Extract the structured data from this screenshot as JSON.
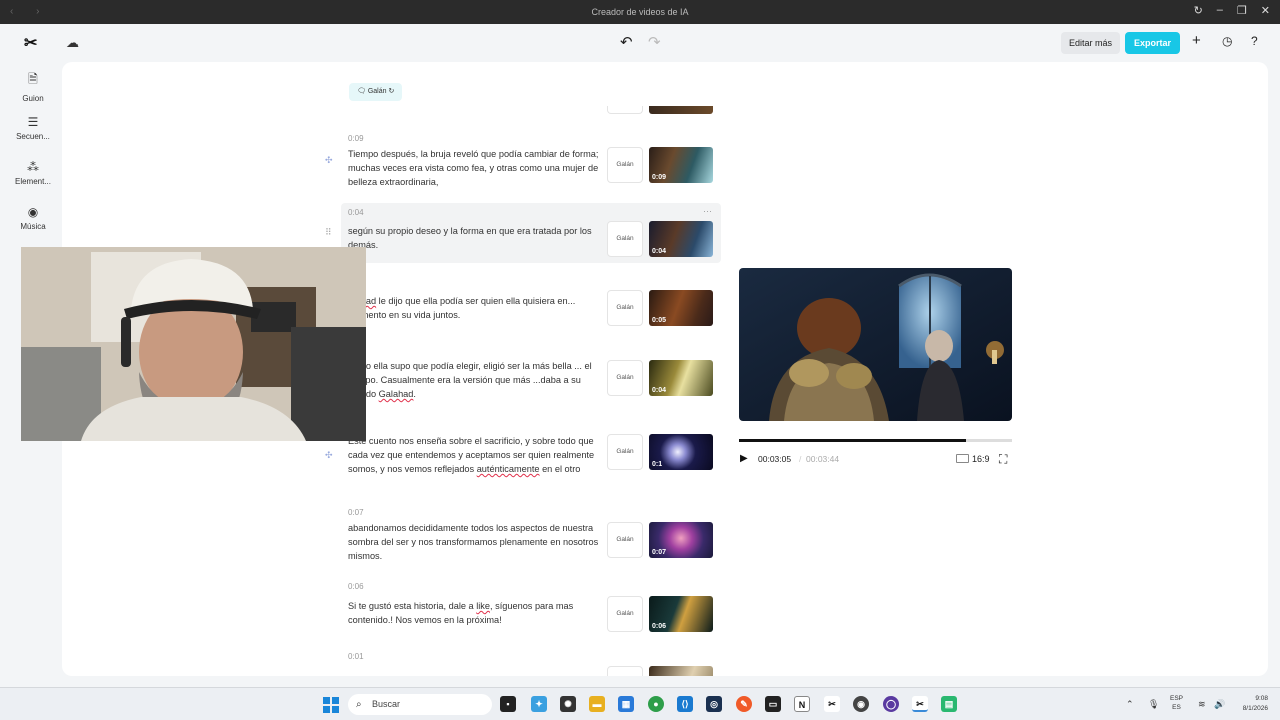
{
  "window": {
    "title": "Creador de videos de IA"
  },
  "toolbar": {
    "logo": "✂",
    "edit_more": "Editar más",
    "export": "Exportar"
  },
  "sidebar": {
    "items": [
      {
        "label": "Guion",
        "icon": "script-icon"
      },
      {
        "label": "Secuen...",
        "icon": "sequence-icon"
      },
      {
        "label": "Element...",
        "icon": "elements-icon"
      },
      {
        "label": "Música",
        "icon": "music-icon"
      }
    ]
  },
  "voice_chip": {
    "label": "Galán"
  },
  "segments": [
    {
      "duration": "0:09",
      "text": "Tiempo después, la bruja reveló que podía cambiar de forma; muchas veces era vista como fea, y otras como una mujer de belleza extraordinaria,",
      "voice": "Galán",
      "thumb_label": "0:09"
    },
    {
      "duration": "0:04",
      "text": "según su propio deseo y la forma en que era tratada por los demás.",
      "voice": "Galán",
      "thumb_label": "0:04"
    },
    {
      "duration": "",
      "text_pre": "",
      "text_wavy": "...ahad",
      "text_post": " le dijo que ella podía ser quien ella quisiera en... momento en su vida juntos.",
      "voice": "Galán",
      "thumb_label": "0:05"
    },
    {
      "duration": "",
      "text_pre": "...ndo ella supo que podía elegir, eligió ser la más bella ... el tiempo. Casualmente era la versión que más ...daba a su amado ",
      "text_wavy": "Galahad",
      "text_post": ".",
      "voice": "Galán",
      "thumb_label": "0:04"
    },
    {
      "duration": "",
      "text_pre": "Este cuento nos enseña sobre el sacrificio, y sobre todo que cada vez que entendemos y aceptamos ser quien realmente somos, y nos vemos reflejados ",
      "text_wavy": "auténticamente",
      "text_post": " en el otro",
      "voice": "Galán",
      "thumb_label": "0:1"
    },
    {
      "duration": "0:07",
      "text": "abandonamos decididamente todos los aspectos de nuestra sombra del ser y nos transformamos plenamente en nosotros mismos.",
      "voice": "Galán",
      "thumb_label": "0:07"
    },
    {
      "duration": "0:06",
      "text_pre": "Si te gustó esta historia, dale a ",
      "text_wavy": "like",
      "text_post": ", síguenos para mas contenido.! Nos vemos en la próxima!",
      "voice": "Galán",
      "thumb_label": "0:06"
    },
    {
      "duration": "0:01"
    }
  ],
  "player": {
    "current": "00:03:05",
    "separator": "/",
    "total": "00:03:44",
    "ratio": "16:9",
    "progress": 0.83
  },
  "taskbar": {
    "search_placeholder": "Buscar",
    "lang_top": "ESP",
    "lang_bottom": "ES",
    "time": "9:08",
    "date": "8/1/2026"
  }
}
